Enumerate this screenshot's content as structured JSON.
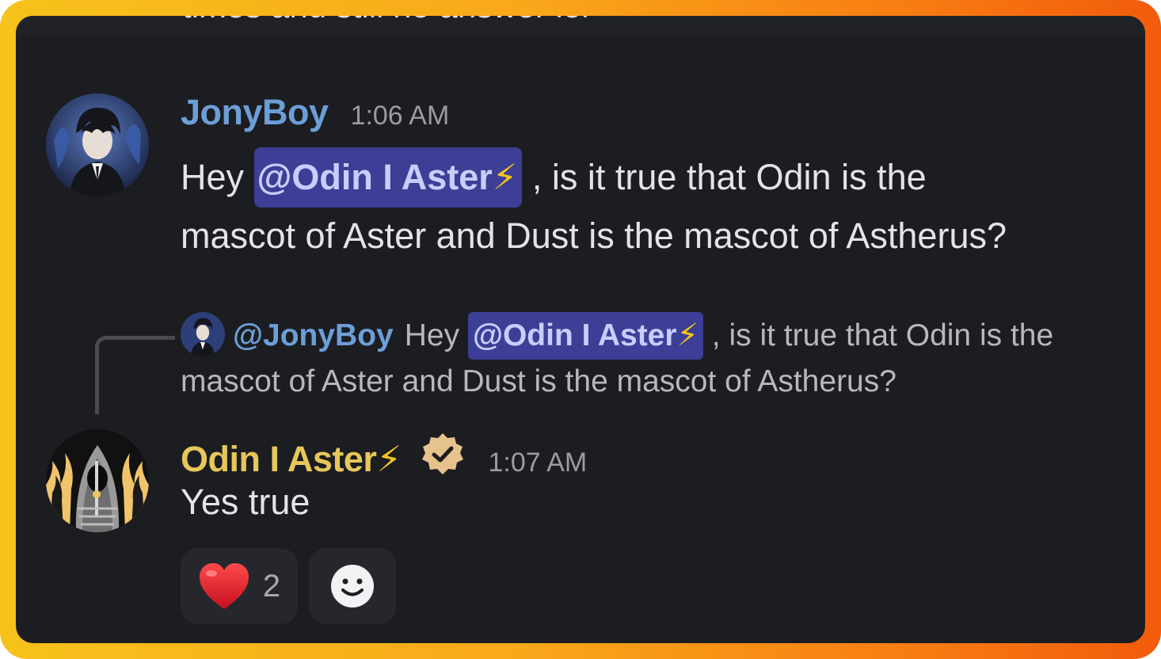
{
  "previous_message": {
    "cut_text": "times and still no answer lol"
  },
  "messages": [
    {
      "username": "JonyBoy",
      "username_color": "#6c9ed8",
      "time": "1:06 AM",
      "avatar": "anime-character-avatar",
      "text_before": "Hey ",
      "mention": "@Odin I Aster",
      "mention_emoji": "⚡",
      "text_line1": ", is it true that Odin is the",
      "text_line2": "mascot of Aster and Dust is the mascot of Astherus?"
    },
    {
      "username": "Odin I Aster",
      "username_emoji": "⚡",
      "username_color": "#e7c75a",
      "verified_badge": "verified-badge-icon",
      "time": "1:07 AM",
      "avatar": "hooded-figure-flames-avatar",
      "reply": {
        "user": "@JonyBoy",
        "text_before": "Hey ",
        "mention": "@Odin I Aster",
        "mention_emoji": "⚡",
        "text_after": ", is it true that Odin is the mascot of Aster and Dust is the mascot of Astherus?"
      },
      "text": "Yes true",
      "reactions": [
        {
          "emoji": "heart",
          "count": "2"
        },
        {
          "emoji": "add-reaction-smiley"
        }
      ]
    }
  ],
  "colors": {
    "frame_gradient_start": "#f7c21b",
    "frame_gradient_end": "#f25b0b",
    "background": "#1c1d21",
    "mention_bg": "#3c3f95",
    "mention_text": "#c9cdff"
  }
}
